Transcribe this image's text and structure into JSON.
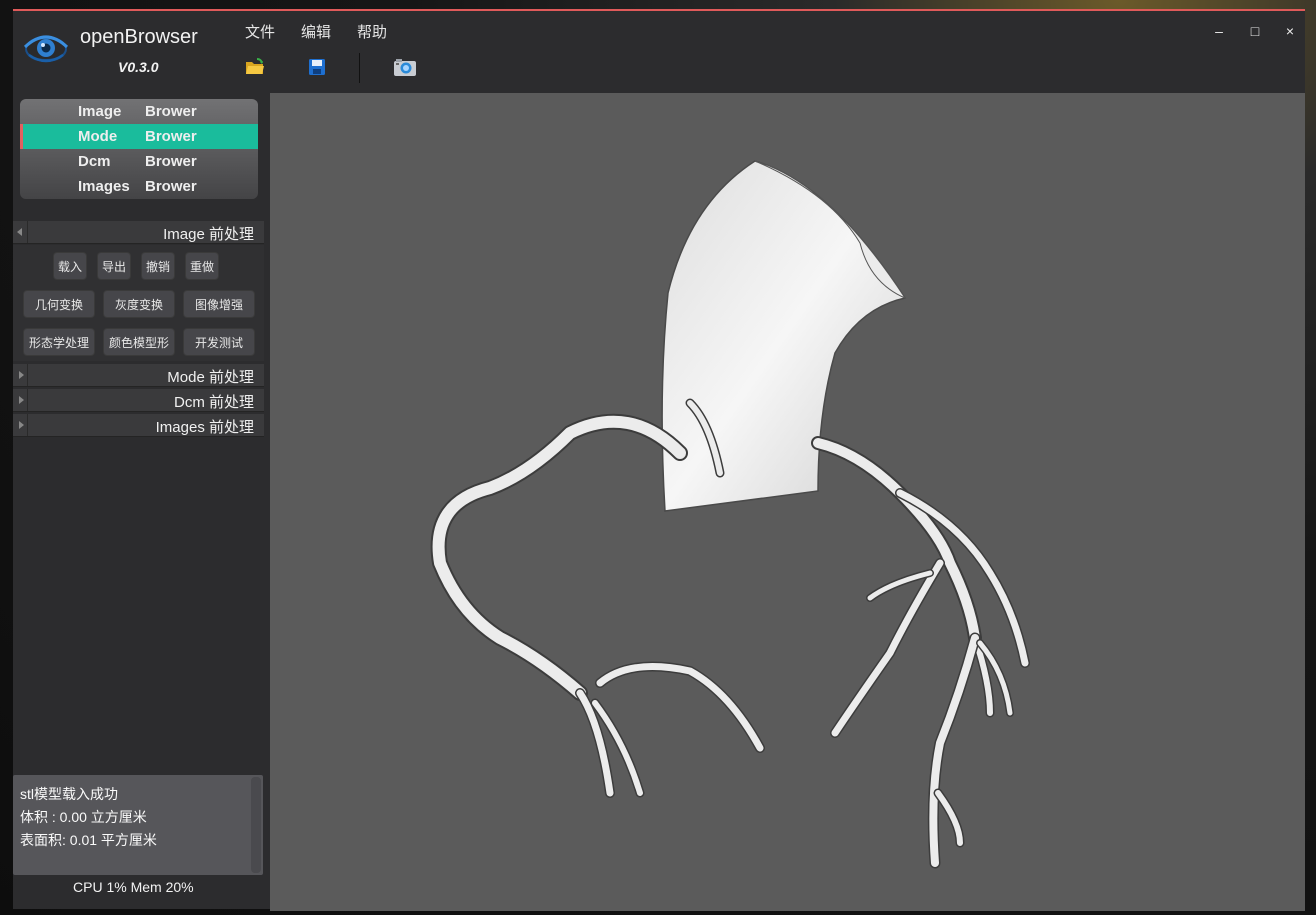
{
  "app": {
    "name": "openBrowser",
    "version": "V0.3.0"
  },
  "menu": [
    {
      "label": "文件"
    },
    {
      "label": "编辑"
    },
    {
      "label": "帮助"
    }
  ],
  "toolbar": [
    {
      "icon": "open-folder-icon"
    },
    {
      "icon": "save-icon"
    },
    {
      "icon": "screenshot-camera-icon"
    }
  ],
  "window_controls": {
    "minimize": "–",
    "maximize": "□",
    "close": "×"
  },
  "browsers": [
    {
      "word1": "Image",
      "word2": "Brower",
      "active": false
    },
    {
      "word1": "Mode",
      "word2": "Brower",
      "active": true
    },
    {
      "word1": "Dcm",
      "word2": "Brower",
      "active": false
    },
    {
      "word1": "Images",
      "word2": "Brower",
      "active": false
    }
  ],
  "sections": {
    "image": "Image  前处理",
    "mode": "Mode  前处理",
    "dcm": "Dcm  前处理",
    "images": "Images  前处理"
  },
  "image_tools": {
    "row1": [
      "载入",
      "导出",
      "撤销",
      "重做"
    ],
    "row2": [
      "几何变换",
      "灰度变换",
      "图像增强"
    ],
    "row3": [
      "形态学处理",
      "颜色模型形",
      "开发测试"
    ]
  },
  "log": {
    "line1": "stl模型载入成功",
    "line2": "体积 : 0.00 立方厘米",
    "line3": "表面积: 0.01 平方厘米"
  },
  "status": {
    "text": "CPU 1%  Mem 20%"
  },
  "colors": {
    "accent": "#1abc9c",
    "active_marker": "#e26060",
    "viewport_bg": "#5b5b5b",
    "panel_bg": "#2c2c2e"
  }
}
